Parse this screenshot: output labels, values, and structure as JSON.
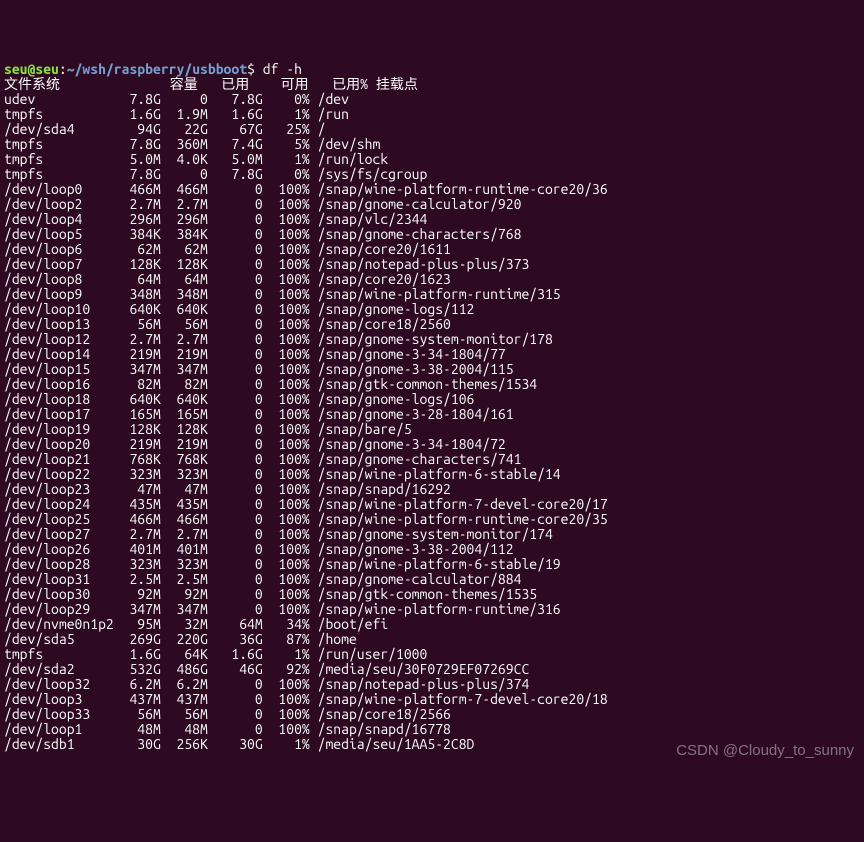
{
  "prompt": {
    "user": "seu",
    "at": "@",
    "host": "seu",
    "colon": ":",
    "path": "~/wsh/raspberry/usbboot",
    "dollar": "$",
    "command": "df -h"
  },
  "header": {
    "fs": "文件系统",
    "size": "容量",
    "used": "已用",
    "avail": "可用",
    "usepct": "已用%",
    "mount": "挂载点"
  },
  "rows": [
    {
      "fs": "udev",
      "size": "7.8G",
      "used": "0",
      "avail": "7.8G",
      "usepct": "0%",
      "mount": "/dev"
    },
    {
      "fs": "tmpfs",
      "size": "1.6G",
      "used": "1.9M",
      "avail": "1.6G",
      "usepct": "1%",
      "mount": "/run"
    },
    {
      "fs": "/dev/sda4",
      "size": "94G",
      "used": "22G",
      "avail": "67G",
      "usepct": "25%",
      "mount": "/"
    },
    {
      "fs": "tmpfs",
      "size": "7.8G",
      "used": "360M",
      "avail": "7.4G",
      "usepct": "5%",
      "mount": "/dev/shm"
    },
    {
      "fs": "tmpfs",
      "size": "5.0M",
      "used": "4.0K",
      "avail": "5.0M",
      "usepct": "1%",
      "mount": "/run/lock"
    },
    {
      "fs": "tmpfs",
      "size": "7.8G",
      "used": "0",
      "avail": "7.8G",
      "usepct": "0%",
      "mount": "/sys/fs/cgroup"
    },
    {
      "fs": "/dev/loop0",
      "size": "466M",
      "used": "466M",
      "avail": "0",
      "usepct": "100%",
      "mount": "/snap/wine-platform-runtime-core20/36"
    },
    {
      "fs": "/dev/loop2",
      "size": "2.7M",
      "used": "2.7M",
      "avail": "0",
      "usepct": "100%",
      "mount": "/snap/gnome-calculator/920"
    },
    {
      "fs": "/dev/loop4",
      "size": "296M",
      "used": "296M",
      "avail": "0",
      "usepct": "100%",
      "mount": "/snap/vlc/2344"
    },
    {
      "fs": "/dev/loop5",
      "size": "384K",
      "used": "384K",
      "avail": "0",
      "usepct": "100%",
      "mount": "/snap/gnome-characters/768"
    },
    {
      "fs": "/dev/loop6",
      "size": "62M",
      "used": "62M",
      "avail": "0",
      "usepct": "100%",
      "mount": "/snap/core20/1611"
    },
    {
      "fs": "/dev/loop7",
      "size": "128K",
      "used": "128K",
      "avail": "0",
      "usepct": "100%",
      "mount": "/snap/notepad-plus-plus/373"
    },
    {
      "fs": "/dev/loop8",
      "size": "64M",
      "used": "64M",
      "avail": "0",
      "usepct": "100%",
      "mount": "/snap/core20/1623"
    },
    {
      "fs": "/dev/loop9",
      "size": "348M",
      "used": "348M",
      "avail": "0",
      "usepct": "100%",
      "mount": "/snap/wine-platform-runtime/315"
    },
    {
      "fs": "/dev/loop10",
      "size": "640K",
      "used": "640K",
      "avail": "0",
      "usepct": "100%",
      "mount": "/snap/gnome-logs/112"
    },
    {
      "fs": "/dev/loop13",
      "size": "56M",
      "used": "56M",
      "avail": "0",
      "usepct": "100%",
      "mount": "/snap/core18/2560"
    },
    {
      "fs": "/dev/loop12",
      "size": "2.7M",
      "used": "2.7M",
      "avail": "0",
      "usepct": "100%",
      "mount": "/snap/gnome-system-monitor/178"
    },
    {
      "fs": "/dev/loop14",
      "size": "219M",
      "used": "219M",
      "avail": "0",
      "usepct": "100%",
      "mount": "/snap/gnome-3-34-1804/77"
    },
    {
      "fs": "/dev/loop15",
      "size": "347M",
      "used": "347M",
      "avail": "0",
      "usepct": "100%",
      "mount": "/snap/gnome-3-38-2004/115"
    },
    {
      "fs": "/dev/loop16",
      "size": "82M",
      "used": "82M",
      "avail": "0",
      "usepct": "100%",
      "mount": "/snap/gtk-common-themes/1534"
    },
    {
      "fs": "/dev/loop18",
      "size": "640K",
      "used": "640K",
      "avail": "0",
      "usepct": "100%",
      "mount": "/snap/gnome-logs/106"
    },
    {
      "fs": "/dev/loop17",
      "size": "165M",
      "used": "165M",
      "avail": "0",
      "usepct": "100%",
      "mount": "/snap/gnome-3-28-1804/161"
    },
    {
      "fs": "/dev/loop19",
      "size": "128K",
      "used": "128K",
      "avail": "0",
      "usepct": "100%",
      "mount": "/snap/bare/5"
    },
    {
      "fs": "/dev/loop20",
      "size": "219M",
      "used": "219M",
      "avail": "0",
      "usepct": "100%",
      "mount": "/snap/gnome-3-34-1804/72"
    },
    {
      "fs": "/dev/loop21",
      "size": "768K",
      "used": "768K",
      "avail": "0",
      "usepct": "100%",
      "mount": "/snap/gnome-characters/741"
    },
    {
      "fs": "/dev/loop22",
      "size": "323M",
      "used": "323M",
      "avail": "0",
      "usepct": "100%",
      "mount": "/snap/wine-platform-6-stable/14"
    },
    {
      "fs": "/dev/loop23",
      "size": "47M",
      "used": "47M",
      "avail": "0",
      "usepct": "100%",
      "mount": "/snap/snapd/16292"
    },
    {
      "fs": "/dev/loop24",
      "size": "435M",
      "used": "435M",
      "avail": "0",
      "usepct": "100%",
      "mount": "/snap/wine-platform-7-devel-core20/17"
    },
    {
      "fs": "/dev/loop25",
      "size": "466M",
      "used": "466M",
      "avail": "0",
      "usepct": "100%",
      "mount": "/snap/wine-platform-runtime-core20/35"
    },
    {
      "fs": "/dev/loop27",
      "size": "2.7M",
      "used": "2.7M",
      "avail": "0",
      "usepct": "100%",
      "mount": "/snap/gnome-system-monitor/174"
    },
    {
      "fs": "/dev/loop26",
      "size": "401M",
      "used": "401M",
      "avail": "0",
      "usepct": "100%",
      "mount": "/snap/gnome-3-38-2004/112"
    },
    {
      "fs": "/dev/loop28",
      "size": "323M",
      "used": "323M",
      "avail": "0",
      "usepct": "100%",
      "mount": "/snap/wine-platform-6-stable/19"
    },
    {
      "fs": "/dev/loop31",
      "size": "2.5M",
      "used": "2.5M",
      "avail": "0",
      "usepct": "100%",
      "mount": "/snap/gnome-calculator/884"
    },
    {
      "fs": "/dev/loop30",
      "size": "92M",
      "used": "92M",
      "avail": "0",
      "usepct": "100%",
      "mount": "/snap/gtk-common-themes/1535"
    },
    {
      "fs": "/dev/loop29",
      "size": "347M",
      "used": "347M",
      "avail": "0",
      "usepct": "100%",
      "mount": "/snap/wine-platform-runtime/316"
    },
    {
      "fs": "/dev/nvme0n1p2",
      "size": "95M",
      "used": "32M",
      "avail": "64M",
      "usepct": "34%",
      "mount": "/boot/efi"
    },
    {
      "fs": "/dev/sda5",
      "size": "269G",
      "used": "220G",
      "avail": "36G",
      "usepct": "87%",
      "mount": "/home"
    },
    {
      "fs": "tmpfs",
      "size": "1.6G",
      "used": "64K",
      "avail": "1.6G",
      "usepct": "1%",
      "mount": "/run/user/1000"
    },
    {
      "fs": "/dev/sda2",
      "size": "532G",
      "used": "486G",
      "avail": "46G",
      "usepct": "92%",
      "mount": "/media/seu/30F0729EF07269CC"
    },
    {
      "fs": "/dev/loop32",
      "size": "6.2M",
      "used": "6.2M",
      "avail": "0",
      "usepct": "100%",
      "mount": "/snap/notepad-plus-plus/374"
    },
    {
      "fs": "/dev/loop3",
      "size": "437M",
      "used": "437M",
      "avail": "0",
      "usepct": "100%",
      "mount": "/snap/wine-platform-7-devel-core20/18"
    },
    {
      "fs": "/dev/loop33",
      "size": "56M",
      "used": "56M",
      "avail": "0",
      "usepct": "100%",
      "mount": "/snap/core18/2566"
    },
    {
      "fs": "/dev/loop1",
      "size": "48M",
      "used": "48M",
      "avail": "0",
      "usepct": "100%",
      "mount": "/snap/snapd/16778"
    },
    {
      "fs": "/dev/sdb1",
      "size": "30G",
      "used": "256K",
      "avail": "30G",
      "usepct": "1%",
      "mount": "/media/seu/1AA5-2C8D"
    }
  ],
  "watermark": "CSDN @Cloudy_to_sunny",
  "col_widths": {
    "fs": 14,
    "size": 6,
    "used": 5,
    "avail": 6,
    "usepct": 5
  }
}
